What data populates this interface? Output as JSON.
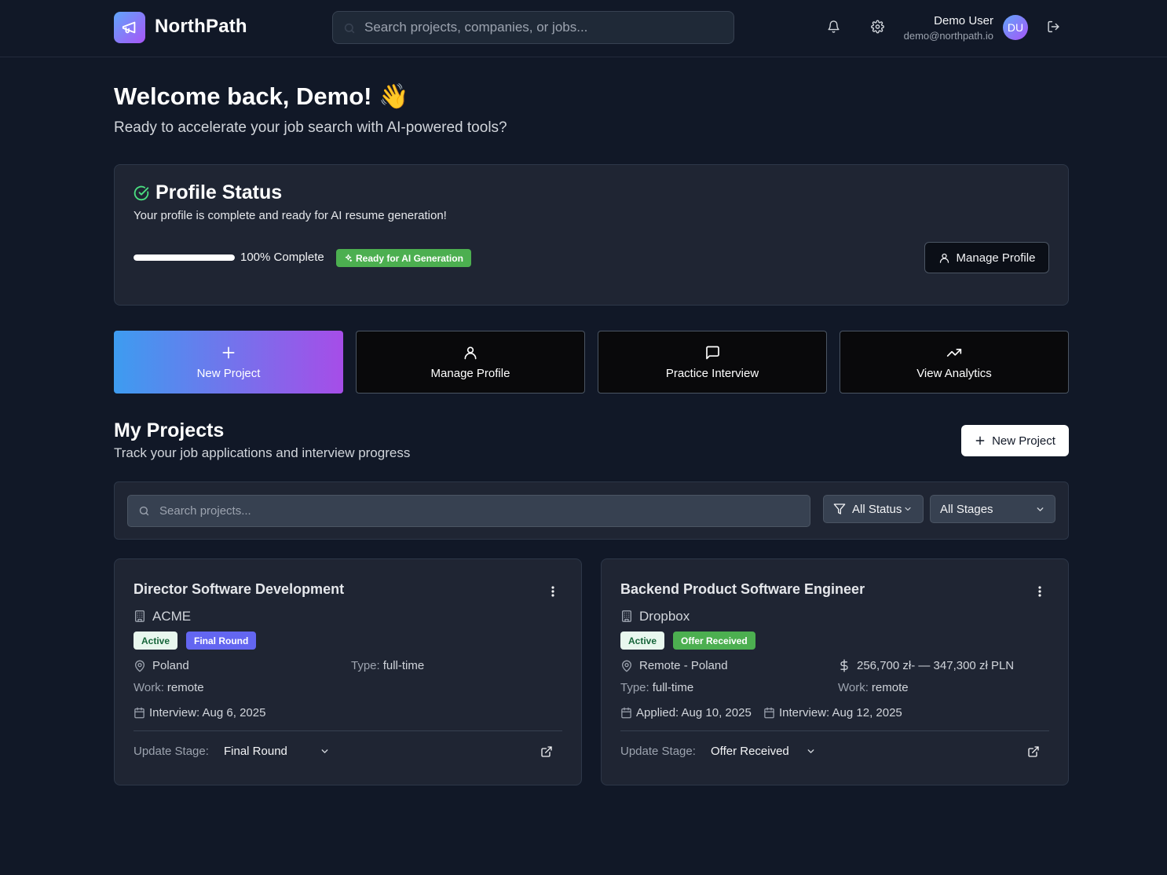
{
  "header": {
    "brand": "NorthPath",
    "search_placeholder": "Search projects, companies, or jobs...",
    "user_name": "Demo User",
    "user_email": "demo@northpath.io",
    "avatar_initials": "DU"
  },
  "welcome": {
    "title": "Welcome back, Demo! 👋",
    "subtitle": "Ready to accelerate your job search with AI-powered tools?"
  },
  "profile_status": {
    "title": "Profile Status",
    "description": "Your profile is complete and ready for AI resume generation!",
    "progress_percent": 100,
    "progress_text": "100% Complete",
    "ready_badge": "Ready for AI Generation",
    "manage_button": "Manage Profile"
  },
  "quick_actions": [
    {
      "label": "New Project",
      "icon": "plus-icon"
    },
    {
      "label": "Manage Profile",
      "icon": "user-icon"
    },
    {
      "label": "Practice Interview",
      "icon": "message-square-icon"
    },
    {
      "label": "View Analytics",
      "icon": "trending-up-icon"
    }
  ],
  "projects": {
    "title": "My Projects",
    "subtitle": "Track your job applications and interview progress",
    "new_button": "New Project",
    "search_placeholder": "Search projects...",
    "status_filter": "All Status",
    "stage_filter": "All Stages",
    "update_stage_label": "Update Stage:",
    "items": [
      {
        "title": "Director Software Development",
        "company": "ACME",
        "status": "Active",
        "stage": "Final Round",
        "location": "Poland",
        "type_label": "Type:",
        "type": "full-time",
        "work_label": "Work:",
        "work": "remote",
        "interview": "Interview: Aug 6, 2025",
        "stage_select": "Final Round"
      },
      {
        "title": "Backend Product Software Engineer",
        "company": "Dropbox",
        "status": "Active",
        "stage": "Offer Received",
        "location": "Remote - Poland",
        "salary": "256,700 zł- — 347,300 zł PLN",
        "type_label": "Type:",
        "type": "full-time",
        "work_label": "Work:",
        "work": "remote",
        "applied": "Applied: Aug 10, 2025",
        "interview": "Interview: Aug 12, 2025",
        "stage_select": "Offer Received"
      }
    ]
  },
  "colors": {
    "background": "#111827",
    "card": "#1f2533",
    "accent_gradient_start": "#3d9cf0",
    "accent_gradient_end": "#a64de8",
    "success": "#4caf50",
    "stage_final": "#6366f1"
  }
}
